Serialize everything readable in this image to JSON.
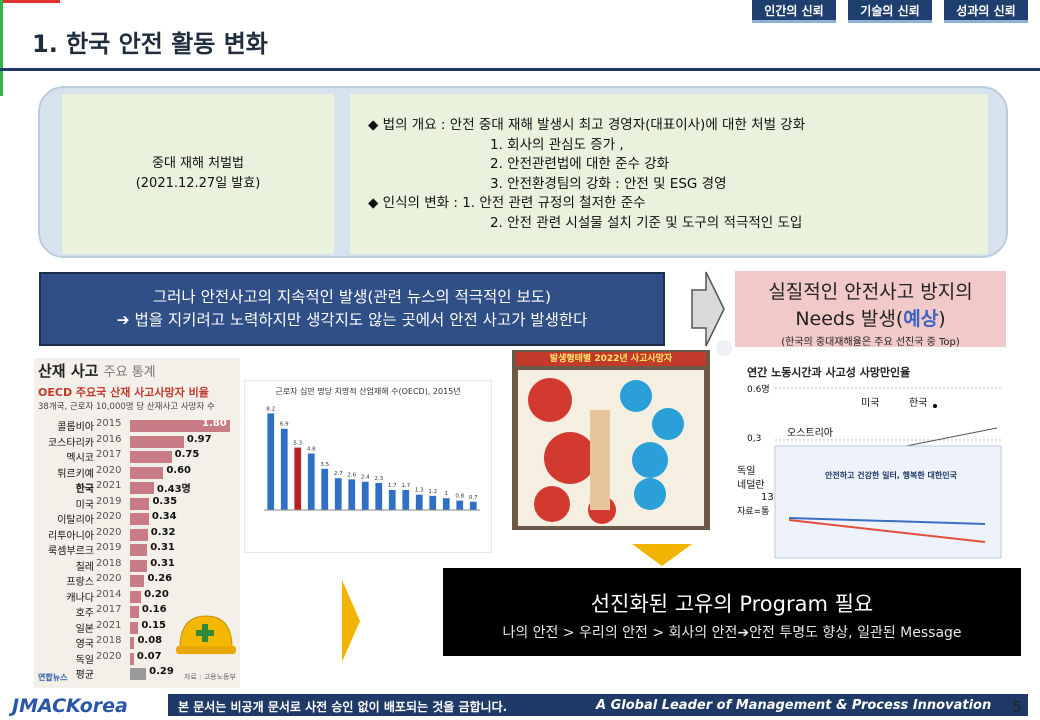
{
  "header": {
    "title": "1. 한국 안전 활동 변화",
    "tabs": [
      "인간의 신뢰",
      "기술의 신뢰",
      "성과의 신뢰"
    ]
  },
  "law": {
    "name": "중대 재해 처벌법",
    "date": "(2021.12.27일 발효)"
  },
  "description": {
    "lines": [
      "◆  법의     개요 : 안전 중대 재해 발생시 최고 경영자(대표이사)에 대한 처벌 강화",
      "1. 회사의 관심도 증가 ,",
      "2. 안전관련법에 대한 준수 강화",
      "3. 안전환경팀의 강화 : 안전 및 ESG 경영",
      "◆  인식의 변화 : 1. 안전 관련 규정의 철저한 준수",
      "2. 안전 관련 시설물 설치 기준 및 도구의 적극적인 도입"
    ]
  },
  "warning": {
    "line1": "그러나  안전사고의 지속적인 발생(관련 뉴스의 적극적인 보도)",
    "line2": "➔ 법을 지키려고 노력하지만 생각지도 않는 곳에서 안전 사고가 발생한다"
  },
  "needs": {
    "line1": "실질적인 안전사고 방지의",
    "line2_pre": "Needs 발생(",
    "line2_hl": "예상",
    "line2_post": ")",
    "line3": "(한국의 중대재해율은 주요 선진국 중 Top)"
  },
  "program": {
    "title": "선진화된 고유의 Program 필요",
    "subtitle": "나의 안전 > 우리의 안전 > 회사의 안전➔안전 투명도 향상, 일관된 Message"
  },
  "stats": {
    "header": "산재 사고",
    "header_sub": "주요 통계",
    "title": "OECD 주요국 산재 사고사망자 비율",
    "note": "38개국, 근로자 10,000명 당 산재사고 사망자 수",
    "rows": [
      {
        "country": "콜롬비아",
        "year": "2015",
        "value": 1.8
      },
      {
        "country": "코스타리카",
        "year": "2016",
        "value": 0.97
      },
      {
        "country": "멕시코",
        "year": "2017",
        "value": 0.75
      },
      {
        "country": "튀르키예",
        "year": "2020",
        "value": 0.6
      },
      {
        "country": "한국",
        "year": "2021",
        "value": 0.43
      },
      {
        "country": "미국",
        "year": "2019",
        "value": 0.35
      },
      {
        "country": "이탈리아",
        "year": "2020",
        "value": 0.34
      },
      {
        "country": "리투아니아",
        "year": "2020",
        "value": 0.32
      },
      {
        "country": "룩셈부르크",
        "year": "2019",
        "value": 0.31
      },
      {
        "country": "칠레",
        "year": "2018",
        "value": 0.31
      },
      {
        "country": "프랑스",
        "year": "2020",
        "value": 0.26
      },
      {
        "country": "캐나다",
        "year": "2014",
        "value": 0.2
      },
      {
        "country": "호주",
        "year": "2017",
        "value": 0.16
      },
      {
        "country": "일본",
        "year": "2021",
        "value": 0.15
      },
      {
        "country": "영국",
        "year": "2018",
        "value": 0.08
      },
      {
        "country": "독일",
        "year": "2020",
        "value": 0.07
      },
      {
        "country": "평균",
        "year": "",
        "value": 0.29
      }
    ],
    "highlight_unit": "명",
    "source": "연합뉴스",
    "source_right": "자료 : 고용노동부"
  },
  "chart_data": {
    "type": "bar",
    "title": "근로자 십만 명당 치명적 산업재해 수(OECD), 2015년",
    "values": [
      8.2,
      6.9,
      5.3,
      4.8,
      3.5,
      2.7,
      2.6,
      2.4,
      2.3,
      1.7,
      1.7,
      1.3,
      1.2,
      1.0,
      0.8,
      0.7
    ],
    "highlight_index": 2,
    "colors": {
      "bar": "#2f6fc6",
      "highlight": "#b32424"
    }
  },
  "news_panel": {
    "title": "발생형태별 2022년 사고사망자"
  },
  "news_panel2": {
    "title": "연간 노동시간과 사고성 사망만인율",
    "label_06": "0.6명",
    "label_03": "0,3",
    "countries": [
      "미국",
      "한국",
      "오스트리아"
    ],
    "left_labels": [
      "독일",
      "네덜란",
      "1300",
      "자료=통"
    ],
    "banner": "안전하고 건강한 일터, 행복한 대한민국"
  },
  "footer": {
    "logo": "JMACKorea",
    "notice": "본 문서는 비공개 문서로 사전 승인 없이 배포되는 것을 금합니다.",
    "slogan": "A Global Leader of Management & Process  Innovation",
    "page": "5"
  }
}
